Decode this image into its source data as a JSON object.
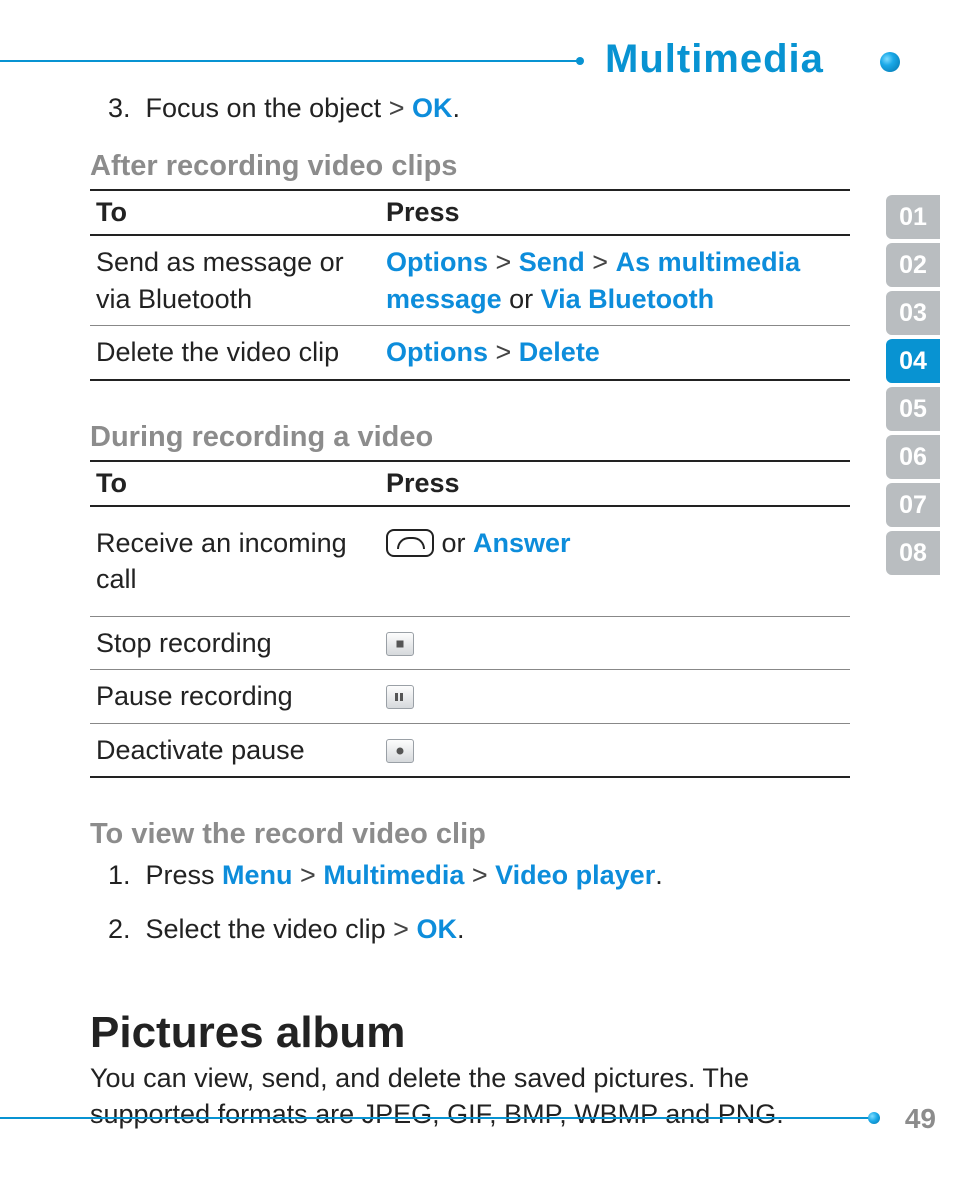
{
  "header": {
    "section_title": "Multimedia"
  },
  "sidebar": {
    "tabs": [
      "01",
      "02",
      "03",
      "04",
      "05",
      "06",
      "07",
      "08"
    ],
    "active_index": 3
  },
  "step3": {
    "num": "3.",
    "pre": "Focus on the object",
    "sep": ">",
    "kw": "OK",
    "post": "."
  },
  "sections": {
    "after": {
      "title": "After recording video clips"
    },
    "during": {
      "title": "During recording a video"
    },
    "view": {
      "title": "To view the record video clip"
    },
    "pictures": {
      "title": "Pictures album",
      "body": "You can view, send, and delete the saved pictures. The supported formats are JPEG, GIF, BMP, WBMP and PNG."
    }
  },
  "table_headers": {
    "to": "To",
    "press": "Press"
  },
  "after_rows": [
    {
      "to": "Send as message or via Bluetooth",
      "press": {
        "parts": [
          "Options",
          " > ",
          "Send",
          " > ",
          "As multimedia message",
          " or ",
          "Via Bluetooth"
        ]
      }
    },
    {
      "to": "Delete the video clip",
      "press": {
        "parts": [
          "Options",
          " > ",
          "Delete"
        ]
      }
    }
  ],
  "during_rows": [
    {
      "to": "Receive an incoming call",
      "icon": "call-key",
      "or": " or ",
      "kw": "Answer"
    },
    {
      "to": "Stop recording",
      "icon": "stop"
    },
    {
      "to": "Pause recording",
      "icon": "pause"
    },
    {
      "to": "Deactivate pause",
      "icon": "rec"
    }
  ],
  "view_steps": [
    {
      "num": "1.",
      "pre": "Press ",
      "kw1": "Menu",
      "s1": " > ",
      "kw2": "Multimedia",
      "s2": " > ",
      "kw3": "Video player",
      "post": "."
    },
    {
      "num": "2.",
      "pre": "Select the video clip ",
      "s1": "> ",
      "kw1": "OK",
      "post": "."
    }
  ],
  "page_number": "49"
}
